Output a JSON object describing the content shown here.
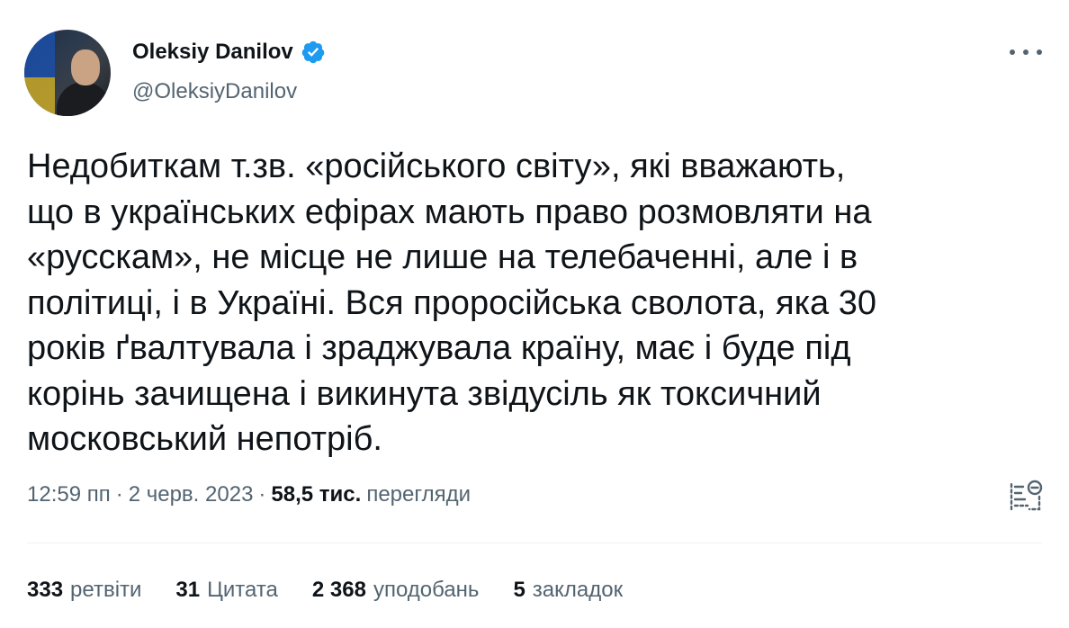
{
  "author": {
    "name": "Oleksiy Danilov",
    "handle": "@OleksiyDanilov",
    "verified_color": "#1d9bf0"
  },
  "tweet": {
    "lines": [
      "Недобиткам т.зв. «російського світу», які вважають,",
      "що в українських ефірах мають право розмовляти на",
      "«русскам», не місце не лише на телебаченні, але і в",
      "політиці, і в Україні. Вся проросійська сволота, яка 30",
      "років ґвалтувала і зраджувала країну, має і буде під",
      "корінь зачищена і викинута звідусіль як токсичний",
      "московський непотріб."
    ]
  },
  "meta": {
    "time": "12:59 пп",
    "sep1": "·",
    "date": "2 черв. 2023",
    "sep2": "·",
    "views_count": "58,5 тис.",
    "views_label": "перегляди"
  },
  "stats": {
    "retweets_count": "333",
    "retweets_label": "ретвіти",
    "quotes_count": "31",
    "quotes_label": "Цитата",
    "likes_count": "2 368",
    "likes_label": "уподобань",
    "bookmarks_count": "5",
    "bookmarks_label": "закладок"
  },
  "icons": {
    "more": "more-options-icon",
    "verified": "verified-badge-icon",
    "analytics": "analytics-icon"
  }
}
